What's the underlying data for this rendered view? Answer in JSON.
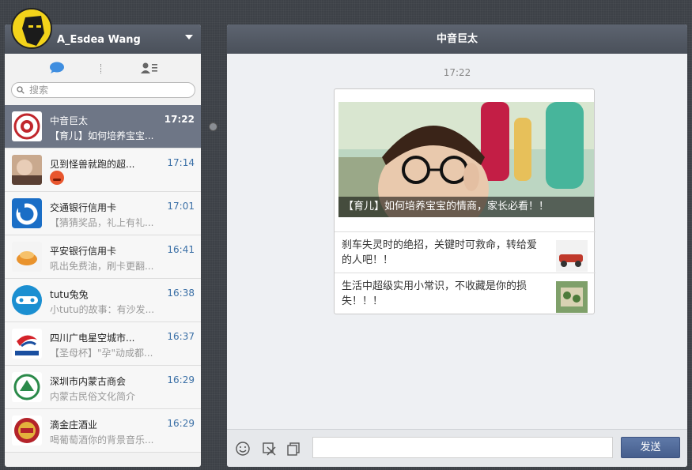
{
  "profile": {
    "name": "A_Esdea Wang"
  },
  "search": {
    "placeholder": "搜索"
  },
  "conversations": [
    {
      "name": "中音巨太",
      "time": "17:22",
      "preview": "【育儿】如何培养宝宝..."
    },
    {
      "name": "见到怪兽就跑的超...",
      "time": "17:14",
      "preview": ""
    },
    {
      "name": "交通银行信用卡",
      "time": "17:01",
      "preview": "【猜猜奖品，礼上有礼..."
    },
    {
      "name": "平安银行信用卡",
      "time": "16:41",
      "preview": "吼出免费油，刷卡更翻..."
    },
    {
      "name": "tutu兔兔",
      "time": "16:38",
      "preview": "小tutu的故事：有沙发..."
    },
    {
      "name": "四川广电星空城市...",
      "time": "16:37",
      "preview": "【圣母杯】\"孕\"动成都..."
    },
    {
      "name": "深圳市内蒙古商会",
      "time": "16:29",
      "preview": "内蒙古民俗文化简介"
    },
    {
      "name": "滴金庄酒业",
      "time": "16:29",
      "preview": "喝葡萄酒你的背景音乐..."
    }
  ],
  "chat": {
    "title": "中音巨太",
    "time": "17:22",
    "card": {
      "caption": "【育儿】如何培养宝宝的情商，家长必看！！",
      "items": [
        {
          "text": "刹车失灵时的绝招，关键时可救命，转给爱的人吧！！"
        },
        {
          "text": "生活中超级实用小常识，不收藏是你的损失！！！"
        }
      ]
    }
  },
  "send_label": "发送",
  "colors": {
    "header": "#4f5661",
    "active_row": "#6e7686",
    "time_blue": "#3a6fa6",
    "send_button": "#4f6898"
  }
}
